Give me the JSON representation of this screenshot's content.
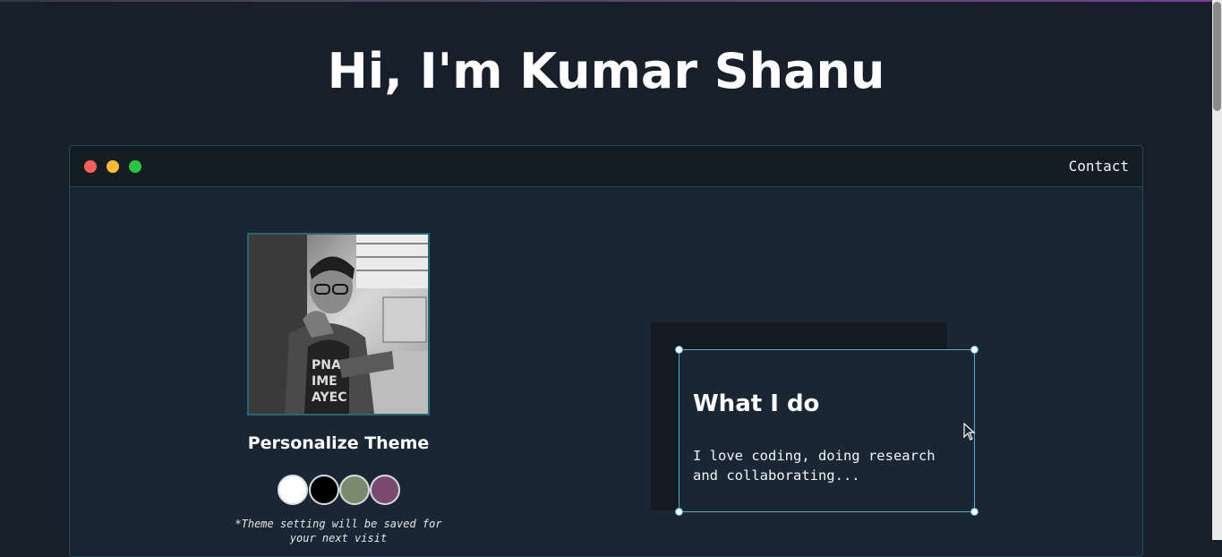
{
  "header": {
    "title": "Hi, I'm Kumar Shanu"
  },
  "window": {
    "nav_contact": "Contact",
    "traffic_lights": [
      "#fe5f57",
      "#febc2e",
      "#27c840"
    ]
  },
  "profile": {
    "avatar_icon": "portrait-photo",
    "personalize_title": "Personalize Theme",
    "theme_swatches": [
      "#ffffff",
      "#000000",
      "#7a8a6a",
      "#7a4a72"
    ],
    "theme_note": "*Theme setting will be saved for your next visit"
  },
  "card": {
    "title": "What I do",
    "text": "I love coding, doing research and collaborating..."
  },
  "colors": {
    "background": "#17202a",
    "window_border": "#1f4a52",
    "accent": "#4fb0c6"
  }
}
